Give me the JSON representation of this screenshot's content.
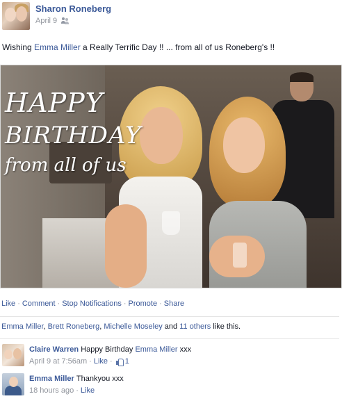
{
  "post": {
    "author": "Sharon Roneberg",
    "date": "April 9",
    "audience_icon": "friends-icon",
    "text_prefix": "Wishing ",
    "mention": "Emma Miller",
    "text_suffix": " a Really Terrific Day !! ... from all of us Roneberg's !!"
  },
  "photo": {
    "overlay_line1": "HAPPY",
    "overlay_line2": "BIRTHDAY",
    "overlay_line3": "from all of us"
  },
  "actions": {
    "like": "Like",
    "comment": "Comment",
    "stop_notifications": "Stop Notifications",
    "promote": "Promote",
    "share": "Share",
    "separator": "·"
  },
  "likes": {
    "name1": "Emma Miller",
    "sep1": ", ",
    "name2": "Brett Roneberg",
    "sep2": ", ",
    "name3": "Michelle Moseley",
    "and": " and ",
    "others": "11 others",
    "suffix": " like this."
  },
  "comments": [
    {
      "author": "Claire Warren",
      "text_prefix": "Happy Birthday ",
      "mention": "Emma Miller",
      "text_suffix": " xxx",
      "timestamp": "April 9 at 7:56am",
      "like_label": "Like",
      "like_count": "1",
      "separator": "·"
    },
    {
      "author": "Emma Miller",
      "text": "Thankyou xxx",
      "timestamp": "18 hours ago",
      "like_label": "Like",
      "separator": "·"
    }
  ],
  "colors": {
    "link": "#3b5998",
    "meta": "#90949c",
    "text": "#141823"
  }
}
